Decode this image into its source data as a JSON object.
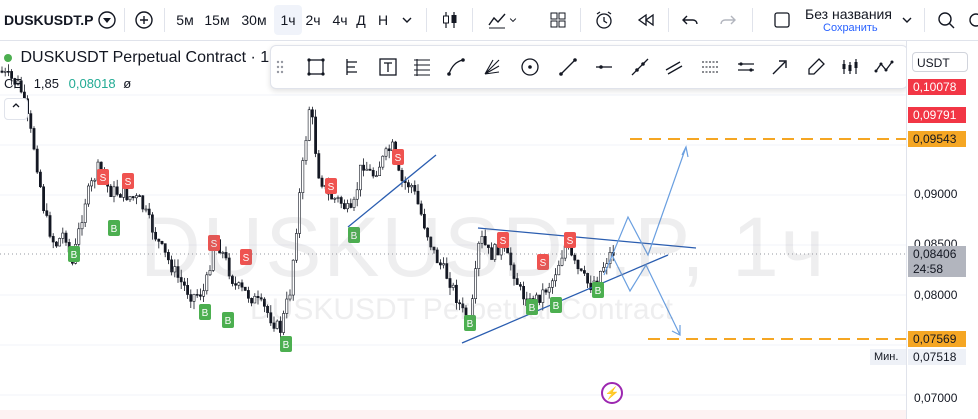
{
  "toolbar": {
    "symbol": "DUSKUSDT.P",
    "intervals": [
      "5м",
      "15м",
      "30м",
      "1ч",
      "2ч",
      "4ч",
      "Д",
      "Н"
    ],
    "active_interval": "1ч",
    "layout_title": "Без названия",
    "layout_subtitle": "Сохранить"
  },
  "legend": {
    "title": "DUSKUSDT Perpetual Contract · 1ч",
    "row2_prefix": "CE",
    "row2_value1": "1,85",
    "row2_value2": "0,08018",
    "row2_value3": "ø"
  },
  "watermark": {
    "main": "DUSKUSDT.P, 1ч",
    "sub": "DUSKUSDT Perpetual Contract"
  },
  "price_scale": {
    "currency": "USDT",
    "ticks": [
      "0,09000",
      "0,08500",
      "0,08000",
      "0,07000"
    ],
    "badge_top": "0,10078",
    "badge_second": "0,09791",
    "badge_upper_line": "0,09543",
    "badge_current": "0,08406",
    "badge_timer": "24:58",
    "badge_lower_line": "0,07569",
    "min_label": "Мин.",
    "min_value": "0,07518"
  },
  "signals": {
    "buy_label": "B",
    "sell_label": "S"
  },
  "colors": {
    "accent": "#2962ff",
    "red_badge": "#f23645",
    "orange": "#f5a623",
    "buy_green": "#4caf50",
    "sell_red": "#ef5350",
    "trendline": "#2a5db0"
  }
}
